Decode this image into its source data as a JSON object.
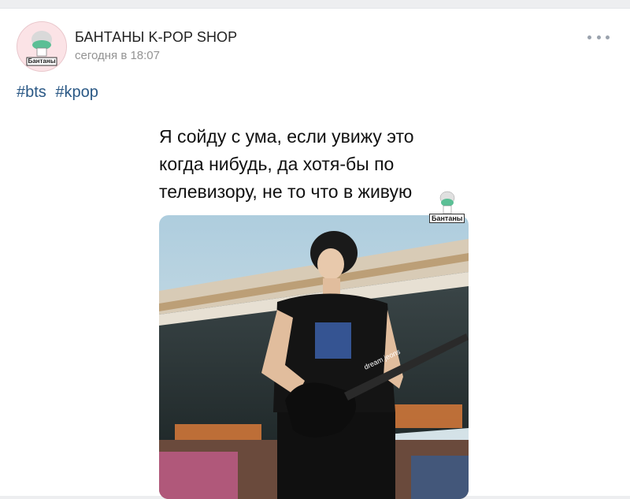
{
  "post": {
    "group_name": "БАНТАНЫ K-POP SHOP",
    "time": "сегодня в 18:07",
    "hashtags": [
      "#bts",
      "#kpop"
    ],
    "caption": "Я сойду с ума, если увижу это\nкогда нибудь, да хотя-бы по\nтелевизору, не то что в живую",
    "avatar_label": "Бантаны",
    "watermark_label": "Бантаны",
    "photo_text": "dream jeons"
  },
  "colors": {
    "link": "#2a5885",
    "secondary_text": "#939393",
    "page_bg": "#edeef0",
    "avatar_bg": "#fbe3e6"
  },
  "icons": {
    "more": "more-horizontal-icon"
  }
}
